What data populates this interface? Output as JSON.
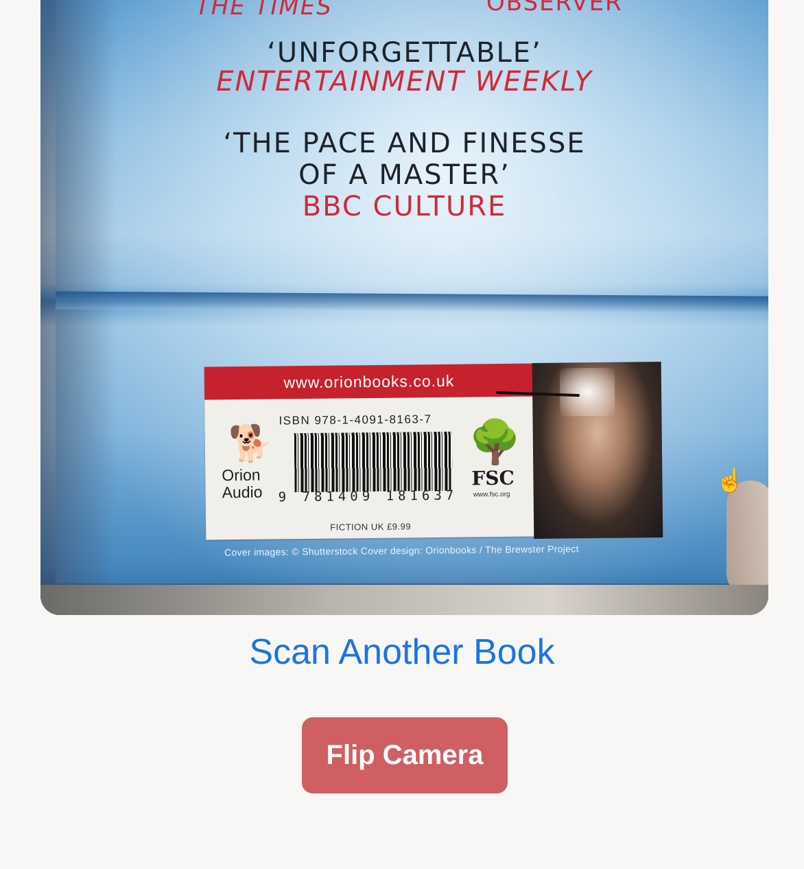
{
  "camera_preview": {
    "cover_quotes": {
      "times_source": "THE TIMES",
      "observer_source_partial": "OBSERVER",
      "quote1": "‘UNFORGETTABLE’",
      "quote1_source": "ENTERTAINMENT WEEKLY",
      "quote2_line1": "‘THE PACE AND FINESSE",
      "quote2_line2": "OF A MASTER’",
      "quote2_source": "BBC CULTURE"
    },
    "label": {
      "url": "www.orionbooks.co.uk",
      "isbn": "ISBN  978-1-4091-8163-7",
      "barcode_digits": "9 781409 181637",
      "publisher_line1": "Orion",
      "publisher_line2": "Audio",
      "fsc": "FSC",
      "fsc_url": "www.fsc.org",
      "category": "FICTION    UK £9.99"
    },
    "credits": "Cover images: © Shutterstock    Cover design: Orionbooks / The Brewster Project"
  },
  "actions": {
    "scan_another_label": "Scan Another Book",
    "flip_camera_label": "Flip Camera"
  },
  "colors": {
    "link": "#1a73e8",
    "flip_button": "#cf5f63",
    "background": "#f8f7f5"
  },
  "icons": {
    "hand_cursor": "hand-pointer-icon",
    "dog_logo": "orion-audio-dog-icon",
    "fsc_tree": "fsc-tree-icon"
  }
}
